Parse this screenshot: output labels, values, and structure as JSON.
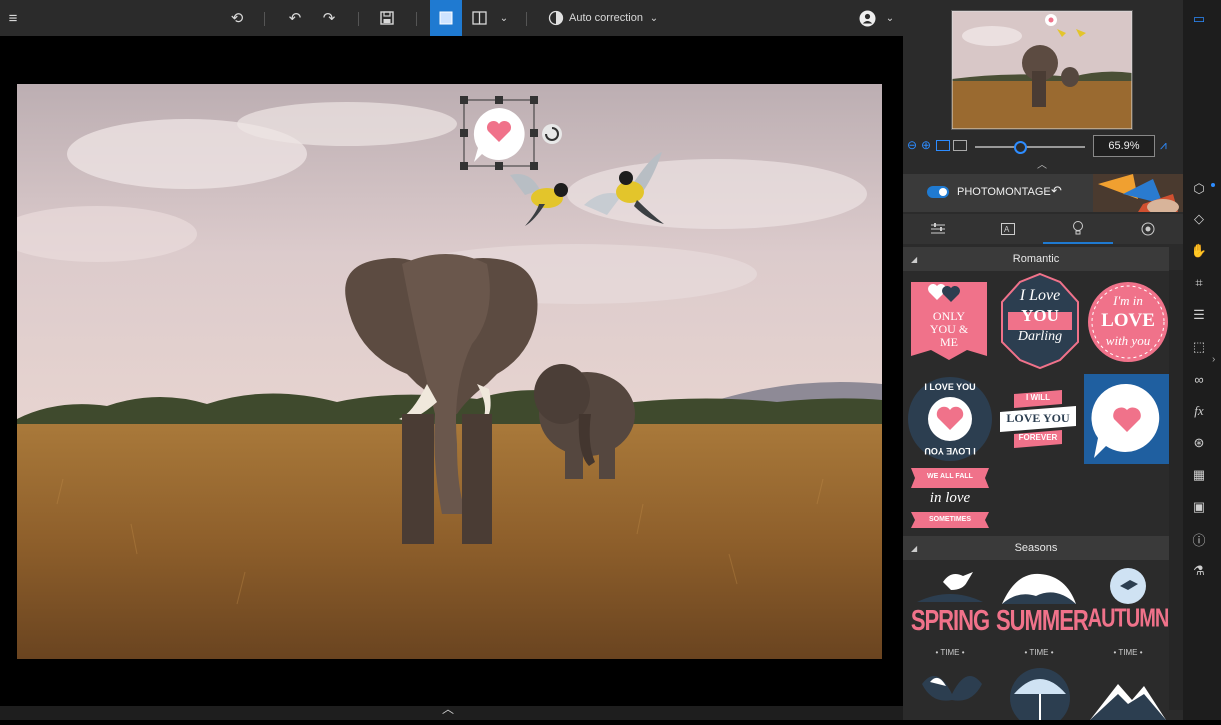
{
  "toolbar": {
    "auto_correction_label": "Auto correction"
  },
  "navigator": {
    "zoom_value": "65.9%"
  },
  "montage": {
    "label": "PHOTOMONTAGE",
    "enabled": true
  },
  "sections": [
    {
      "title": "Romantic"
    },
    {
      "title": "Seasons"
    }
  ],
  "stickers": {
    "romantic": [
      {
        "name": "only-you-and-me",
        "lines": [
          "ONLY",
          "YOU &",
          "ME"
        ]
      },
      {
        "name": "i-love-you-darling",
        "lines": [
          "I Love",
          "YOU",
          "Darling"
        ]
      },
      {
        "name": "im-in-love-with-you",
        "lines": [
          "I'm in",
          "LOVE",
          "with you"
        ]
      },
      {
        "name": "i-love-you-circle",
        "lines": [
          "I LOVE YOU",
          "I LOVE YOU"
        ]
      },
      {
        "name": "i-will-love-you-forever",
        "lines": [
          "I WILL",
          "LOVE YOU",
          "FOREVER"
        ]
      },
      {
        "name": "heart-speech-bubble",
        "lines": []
      },
      {
        "name": "we-all-fall-in-love",
        "lines": [
          "WE ALL FALL",
          "in love",
          "SOMETIMES"
        ]
      }
    ],
    "seasons": [
      {
        "name": "spring",
        "word": "SPRING",
        "sub": "• TIME •"
      },
      {
        "name": "summer",
        "word": "SUMMER",
        "sub": "• TIME •"
      },
      {
        "name": "autumn",
        "word": "AUTUMN",
        "sub": "• TIME •"
      }
    ]
  },
  "colors": {
    "accent": "#1f7ad1",
    "sticker_pink": "#f0728a",
    "sticker_navy": "#2c3e50"
  }
}
